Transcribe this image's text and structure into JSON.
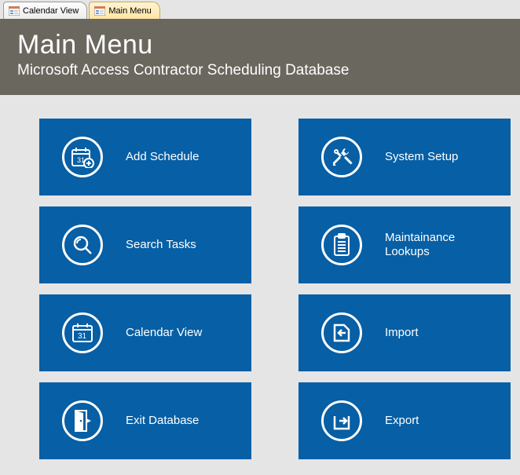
{
  "tabs": [
    {
      "label": "Calendar View",
      "active": false
    },
    {
      "label": "Main Menu",
      "active": true
    }
  ],
  "header": {
    "title": "Main Menu",
    "subtitle": "Microsoft Access Contractor Scheduling Database"
  },
  "tiles": {
    "left": [
      {
        "id": "add-schedule",
        "label": "Add Schedule",
        "icon": "calendar-add-icon"
      },
      {
        "id": "search-tasks",
        "label": "Search Tasks",
        "icon": "search-icon"
      },
      {
        "id": "calendar-view",
        "label": "Calendar View",
        "icon": "calendar-icon"
      },
      {
        "id": "exit-database",
        "label": "Exit Database",
        "icon": "exit-door-icon"
      }
    ],
    "right": [
      {
        "id": "system-setup",
        "label": "System Setup",
        "icon": "tools-icon"
      },
      {
        "id": "maint-lookups",
        "label": "Maintainance Lookups",
        "icon": "clipboard-icon"
      },
      {
        "id": "import",
        "label": "Import",
        "icon": "import-icon"
      },
      {
        "id": "export",
        "label": "Export",
        "icon": "export-icon"
      }
    ]
  },
  "colors": {
    "tile": "#075fa5",
    "header": "#6a675f"
  }
}
